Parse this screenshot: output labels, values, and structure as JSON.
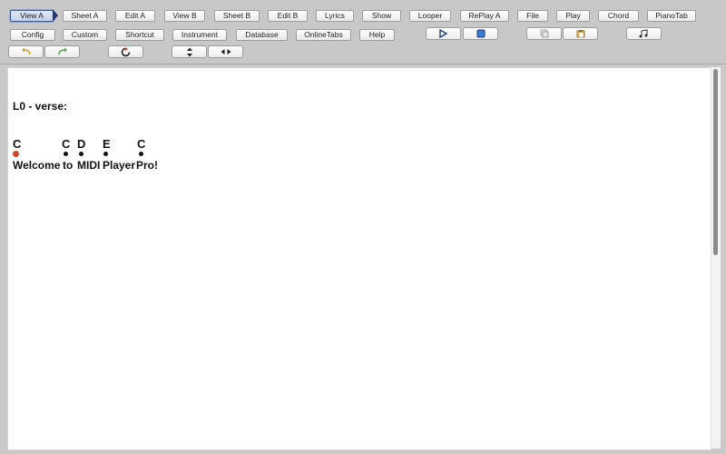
{
  "toolbar": {
    "row1": [
      {
        "id": "view-a",
        "label": "View A",
        "active": true
      },
      {
        "id": "sheet-a",
        "label": "Sheet A"
      },
      {
        "id": "edit-a",
        "label": "Edit A"
      },
      {
        "id": "view-b",
        "label": "View B"
      },
      {
        "id": "sheet-b",
        "label": "Sheet B"
      },
      {
        "id": "edit-b",
        "label": "Edit B"
      },
      {
        "id": "lyrics",
        "label": "Lyrics"
      },
      {
        "id": "show",
        "label": "Show"
      },
      {
        "id": "looper",
        "label": "Looper"
      },
      {
        "id": "replay-a",
        "label": "RePlay A"
      },
      {
        "id": "file",
        "label": "File"
      },
      {
        "id": "play",
        "label": "Play"
      },
      {
        "id": "chord",
        "label": "Chord"
      },
      {
        "id": "pianotab",
        "label": "PianoTab"
      }
    ],
    "row2": [
      {
        "id": "config",
        "label": "Config"
      },
      {
        "id": "custom",
        "label": "Custom"
      },
      {
        "id": "shortcut",
        "label": "Shortcut"
      },
      {
        "id": "instrument",
        "label": "Instrument"
      },
      {
        "id": "database",
        "label": "Database"
      },
      {
        "id": "onlinetabs",
        "label": "OnlineTabs"
      },
      {
        "id": "help",
        "label": "Help"
      }
    ],
    "icons": {
      "play": "play-icon",
      "stop": "stop-icon",
      "copy": "copy-icon",
      "paste": "paste-icon",
      "music": "music-notes-icon",
      "undo": "undo-icon",
      "redo": "redo-icon",
      "rewind": "rewind-icon",
      "vertical": "vertical-arrows-icon",
      "horizontal": "horizontal-arrows-icon"
    }
  },
  "colors": {
    "toolbar_bg": "#c8c8c8",
    "active_border": "#3c5a9a",
    "current_dot": "#d2452c"
  },
  "song": {
    "section_label": "L0 - verse:",
    "chords": [
      "C",
      "C",
      "D",
      "E",
      "C"
    ],
    "lyrics": [
      "Welcome",
      "to",
      "MIDI",
      "Player",
      "Pro!"
    ]
  }
}
